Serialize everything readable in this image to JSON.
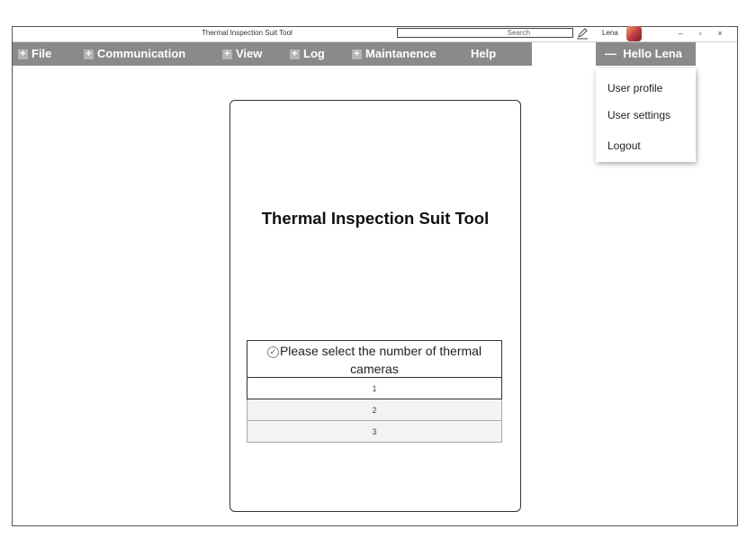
{
  "window": {
    "title": "Thermal Inspection Suit Tool"
  },
  "search": {
    "placeholder": "Search"
  },
  "user": {
    "name": "Lena"
  },
  "window_controls": {
    "minimize": "–",
    "restore": "▫",
    "close": "×"
  },
  "menu": [
    {
      "label": "File"
    },
    {
      "label": "Communication"
    },
    {
      "label": "View"
    },
    {
      "label": "Log"
    },
    {
      "label": "Maintanence"
    },
    {
      "label": "Help"
    }
  ],
  "user_menu": {
    "label": "Hello Lena",
    "toggle_glyph": "—",
    "items": [
      {
        "label": "User profile"
      },
      {
        "label": "User settings"
      },
      {
        "label": "Logout"
      }
    ]
  },
  "card": {
    "title": "Thermal Inspection Suit Tool",
    "selector_prompt": "Please select the number of thermal cameras",
    "options": [
      "1",
      "2",
      "3"
    ]
  },
  "icons": {
    "edit": "pencil-icon",
    "expand": "plus-icon",
    "check": "check-icon"
  }
}
